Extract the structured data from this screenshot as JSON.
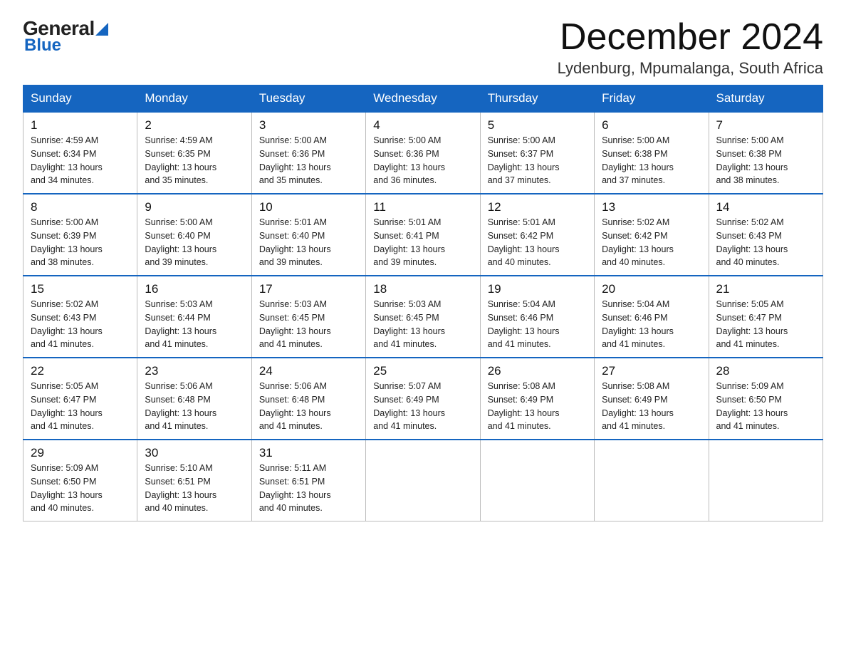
{
  "header": {
    "logo_general": "General",
    "logo_blue": "Blue",
    "month_year": "December 2024",
    "location": "Lydenburg, Mpumalanga, South Africa"
  },
  "weekdays": [
    "Sunday",
    "Monday",
    "Tuesday",
    "Wednesday",
    "Thursday",
    "Friday",
    "Saturday"
  ],
  "weeks": [
    [
      {
        "day": "1",
        "sunrise": "4:59 AM",
        "sunset": "6:34 PM",
        "daylight": "13 hours and 34 minutes."
      },
      {
        "day": "2",
        "sunrise": "4:59 AM",
        "sunset": "6:35 PM",
        "daylight": "13 hours and 35 minutes."
      },
      {
        "day": "3",
        "sunrise": "5:00 AM",
        "sunset": "6:36 PM",
        "daylight": "13 hours and 35 minutes."
      },
      {
        "day": "4",
        "sunrise": "5:00 AM",
        "sunset": "6:36 PM",
        "daylight": "13 hours and 36 minutes."
      },
      {
        "day": "5",
        "sunrise": "5:00 AM",
        "sunset": "6:37 PM",
        "daylight": "13 hours and 37 minutes."
      },
      {
        "day": "6",
        "sunrise": "5:00 AM",
        "sunset": "6:38 PM",
        "daylight": "13 hours and 37 minutes."
      },
      {
        "day": "7",
        "sunrise": "5:00 AM",
        "sunset": "6:38 PM",
        "daylight": "13 hours and 38 minutes."
      }
    ],
    [
      {
        "day": "8",
        "sunrise": "5:00 AM",
        "sunset": "6:39 PM",
        "daylight": "13 hours and 38 minutes."
      },
      {
        "day": "9",
        "sunrise": "5:00 AM",
        "sunset": "6:40 PM",
        "daylight": "13 hours and 39 minutes."
      },
      {
        "day": "10",
        "sunrise": "5:01 AM",
        "sunset": "6:40 PM",
        "daylight": "13 hours and 39 minutes."
      },
      {
        "day": "11",
        "sunrise": "5:01 AM",
        "sunset": "6:41 PM",
        "daylight": "13 hours and 39 minutes."
      },
      {
        "day": "12",
        "sunrise": "5:01 AM",
        "sunset": "6:42 PM",
        "daylight": "13 hours and 40 minutes."
      },
      {
        "day": "13",
        "sunrise": "5:02 AM",
        "sunset": "6:42 PM",
        "daylight": "13 hours and 40 minutes."
      },
      {
        "day": "14",
        "sunrise": "5:02 AM",
        "sunset": "6:43 PM",
        "daylight": "13 hours and 40 minutes."
      }
    ],
    [
      {
        "day": "15",
        "sunrise": "5:02 AM",
        "sunset": "6:43 PM",
        "daylight": "13 hours and 41 minutes."
      },
      {
        "day": "16",
        "sunrise": "5:03 AM",
        "sunset": "6:44 PM",
        "daylight": "13 hours and 41 minutes."
      },
      {
        "day": "17",
        "sunrise": "5:03 AM",
        "sunset": "6:45 PM",
        "daylight": "13 hours and 41 minutes."
      },
      {
        "day": "18",
        "sunrise": "5:03 AM",
        "sunset": "6:45 PM",
        "daylight": "13 hours and 41 minutes."
      },
      {
        "day": "19",
        "sunrise": "5:04 AM",
        "sunset": "6:46 PM",
        "daylight": "13 hours and 41 minutes."
      },
      {
        "day": "20",
        "sunrise": "5:04 AM",
        "sunset": "6:46 PM",
        "daylight": "13 hours and 41 minutes."
      },
      {
        "day": "21",
        "sunrise": "5:05 AM",
        "sunset": "6:47 PM",
        "daylight": "13 hours and 41 minutes."
      }
    ],
    [
      {
        "day": "22",
        "sunrise": "5:05 AM",
        "sunset": "6:47 PM",
        "daylight": "13 hours and 41 minutes."
      },
      {
        "day": "23",
        "sunrise": "5:06 AM",
        "sunset": "6:48 PM",
        "daylight": "13 hours and 41 minutes."
      },
      {
        "day": "24",
        "sunrise": "5:06 AM",
        "sunset": "6:48 PM",
        "daylight": "13 hours and 41 minutes."
      },
      {
        "day": "25",
        "sunrise": "5:07 AM",
        "sunset": "6:49 PM",
        "daylight": "13 hours and 41 minutes."
      },
      {
        "day": "26",
        "sunrise": "5:08 AM",
        "sunset": "6:49 PM",
        "daylight": "13 hours and 41 minutes."
      },
      {
        "day": "27",
        "sunrise": "5:08 AM",
        "sunset": "6:49 PM",
        "daylight": "13 hours and 41 minutes."
      },
      {
        "day": "28",
        "sunrise": "5:09 AM",
        "sunset": "6:50 PM",
        "daylight": "13 hours and 41 minutes."
      }
    ],
    [
      {
        "day": "29",
        "sunrise": "5:09 AM",
        "sunset": "6:50 PM",
        "daylight": "13 hours and 40 minutes."
      },
      {
        "day": "30",
        "sunrise": "5:10 AM",
        "sunset": "6:51 PM",
        "daylight": "13 hours and 40 minutes."
      },
      {
        "day": "31",
        "sunrise": "5:11 AM",
        "sunset": "6:51 PM",
        "daylight": "13 hours and 40 minutes."
      },
      null,
      null,
      null,
      null
    ]
  ],
  "labels": {
    "sunrise": "Sunrise:",
    "sunset": "Sunset:",
    "daylight": "Daylight:"
  }
}
